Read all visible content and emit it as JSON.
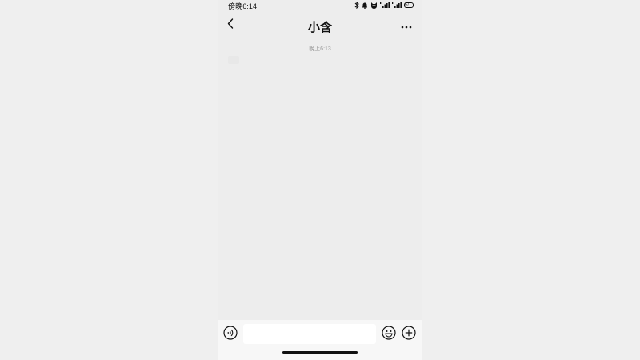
{
  "status_bar": {
    "time": "傍晚6:14",
    "battery": "67",
    "icons": [
      "bluetooth-icon",
      "bell-icon",
      "cat-icon",
      "signal-icon",
      "signal-icon",
      "battery-icon"
    ]
  },
  "header": {
    "title": "小含",
    "back_icon": "chevron-left-icon",
    "more_icon": "more-icon"
  },
  "messages": {
    "timestamp": "晚上6:13"
  },
  "input_bar": {
    "value": "",
    "placeholder": "",
    "voice_icon": "voice-icon",
    "emoji_icon": "emoji-icon",
    "plus_icon": "plus-icon"
  }
}
